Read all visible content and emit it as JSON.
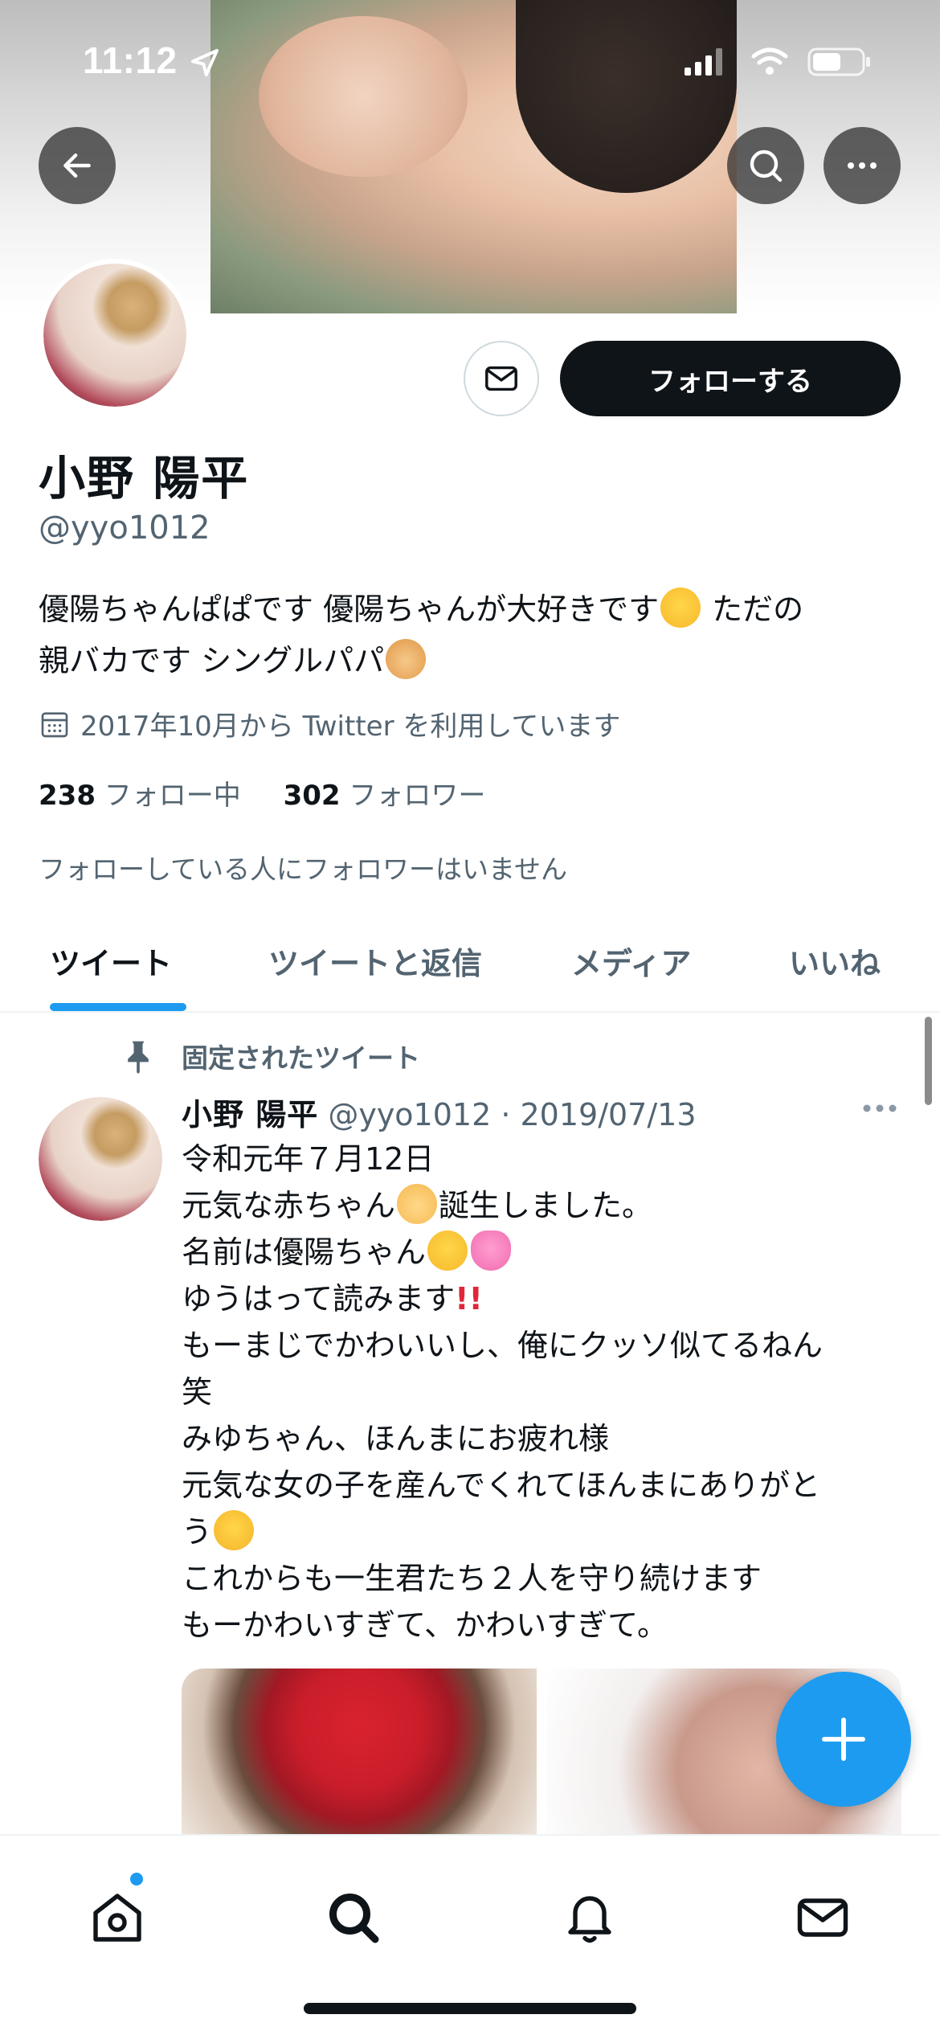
{
  "status_bar": {
    "time": "11:12"
  },
  "profile": {
    "follow_label": "フォローする",
    "name": "小野 陽平",
    "handle": "@yyo1012",
    "bio_line1a": "優陽ちゃんぱぱです 優陽ちゃんが大好きです",
    "bio_line1b": " ただの",
    "bio_line2": "親バカです シングルパパ",
    "joined": "2017年10月から Twitter を利用しています",
    "following_count": "238",
    "following_label": "フォロー中",
    "followers_count": "302",
    "followers_label": "フォロワー",
    "followers_note": "フォローしている人にフォロワーはいません"
  },
  "tabs": [
    {
      "label": "ツイート"
    },
    {
      "label": "ツイートと返信"
    },
    {
      "label": "メディア"
    },
    {
      "label": "いいね"
    }
  ],
  "tweet": {
    "pinned_label": "固定されたツイート",
    "author_name": "小野 陽平",
    "meta": "@yyo1012 · 2019/07/13",
    "lines": {
      "l1": "令和元年７月12日",
      "l2a": "元気な赤ちゃん",
      "l2b": "誕生しました。",
      "l3": "名前は優陽ちゃん",
      "l4": "ゆうはって読みます",
      "l5": "もーまじでかわいいし、俺にクッソ似てるねん",
      "l6": "笑",
      "l7": "みゆちゃん、ほんまにお疲れ様",
      "l8": "元気な女の子を産んでくれてほんまにありがと",
      "l9": "う",
      "l10": "これからも一生君たち２人を守り続けます",
      "l11": "もーかわいすぎて、かわいすぎて。"
    }
  },
  "colors": {
    "accent": "#1d9bf0",
    "text": "#0f1419",
    "secondary": "#536471"
  },
  "icons": [
    "location-arrow-icon",
    "signal-icon",
    "wifi-icon",
    "battery-icon",
    "back-arrow-icon",
    "search-icon",
    "more-icon",
    "mail-icon",
    "calendar-icon",
    "pin-icon",
    "compose-plus-icon",
    "home-icon",
    "notifications-bell-icon",
    "messages-mail-icon"
  ]
}
